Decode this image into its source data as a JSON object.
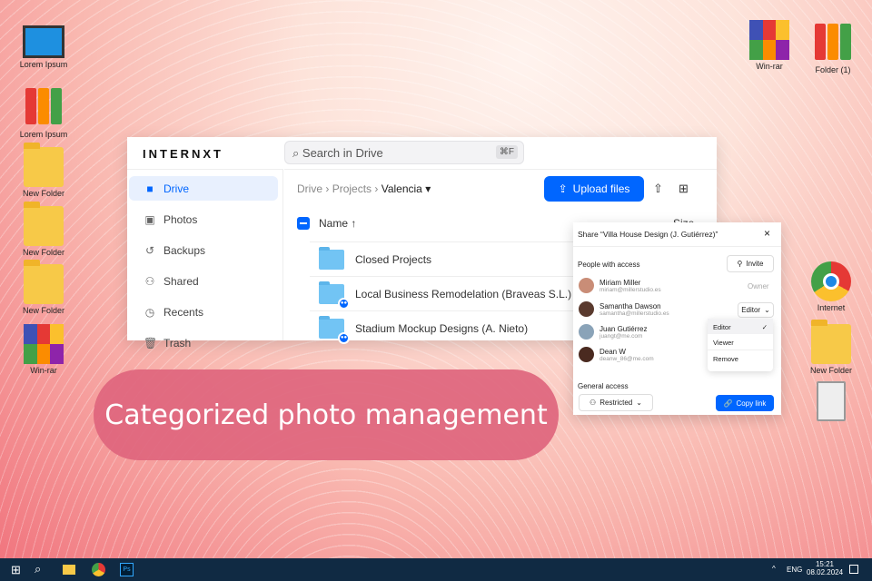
{
  "desktop": {
    "left_icons": [
      "Lorem Ipsum",
      "Lorem Ipsum",
      "New Folder",
      "New Folder",
      "New Folder",
      "Win-rar"
    ],
    "top_right_icons": [
      "Win-rar",
      "Folder (1)"
    ],
    "right_icons": [
      "Internet",
      "New Folder"
    ]
  },
  "drive": {
    "logo": "INTERNXT",
    "search_placeholder": "Search in Drive",
    "search_shortcut": "⌘F",
    "sidebar": [
      {
        "label": "Drive",
        "icon": "folder-icon"
      },
      {
        "label": "Photos",
        "icon": "image-icon"
      },
      {
        "label": "Backups",
        "icon": "history-icon"
      },
      {
        "label": "Shared",
        "icon": "users-icon"
      },
      {
        "label": "Recents",
        "icon": "clock-icon"
      },
      {
        "label": "Trash",
        "icon": "trash-icon"
      }
    ],
    "breadcrumb": [
      "Drive",
      "Projects",
      "Valencia"
    ],
    "upload_label": "Upload files",
    "columns": {
      "name": "Name ↑",
      "size": "Size"
    },
    "rows": [
      "Closed Projects",
      "Local Business Remodelation (Braveas S.L.)",
      "Stadium Mockup Designs (A. Nieto)"
    ]
  },
  "share": {
    "title": "Share “Villa House Design (J. Gutiérrez)”",
    "people_label": "People with access",
    "invite_label": "Invite",
    "people": [
      {
        "name": "Miriam Miller",
        "email": "miriam@millerstudio.es",
        "role": "Owner"
      },
      {
        "name": "Samantha Dawson",
        "email": "samantha@millerstudio.es",
        "role": "Editor"
      },
      {
        "name": "Juan Gutiérrez",
        "email": "juangt@me.com"
      },
      {
        "name": "Dean W",
        "email": "deanw_86@me.com"
      }
    ],
    "menu": [
      "Editor",
      "Viewer",
      "Remove"
    ],
    "general_label": "General access",
    "restricted_label": "Restricted",
    "copy_label": "Copy link"
  },
  "banner": "Categorized photo management",
  "taskbar": {
    "lang": "ENG",
    "time": "15:21",
    "date": "08.02.2024"
  }
}
